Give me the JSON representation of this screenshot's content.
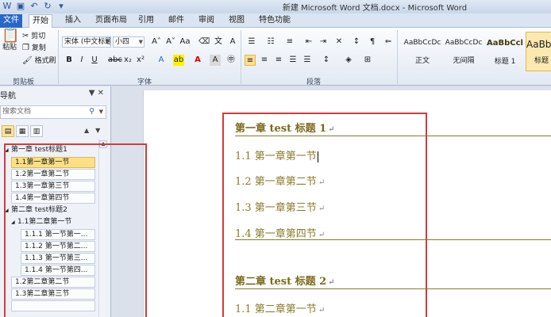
{
  "window": {
    "title": "新建 Microsoft Word 文档.docx - Microsoft Word"
  },
  "ribbon": {
    "tabs": [
      {
        "label": "文件"
      },
      {
        "label": "开始"
      },
      {
        "label": "插入"
      },
      {
        "label": "页面布局"
      },
      {
        "label": "引用"
      },
      {
        "label": "邮件"
      },
      {
        "label": "审阅"
      },
      {
        "label": "视图"
      },
      {
        "label": "特色功能"
      }
    ],
    "clipboard": {
      "paste": "粘贴",
      "cut": "剪切",
      "copy": "复制",
      "format_painter": "格式刷",
      "group": "剪贴板"
    },
    "font": {
      "name": "宋体 (中文标题",
      "size": "小四",
      "group": "字体"
    },
    "paragraph": {
      "group": "段落"
    },
    "styles": [
      {
        "preview": "AaBbCcDc",
        "name": "正文"
      },
      {
        "preview": "AaBbCcDc",
        "name": "无间隔"
      },
      {
        "preview": "AaBbCcl",
        "name": "标题 1"
      },
      {
        "preview": "AaBbC",
        "name": "标题"
      }
    ]
  },
  "nav": {
    "title": "导航",
    "search_placeholder": "搜索文档",
    "tree": [
      {
        "label": "第一章  test标题1",
        "level": 0,
        "expand": "◢"
      },
      {
        "label": "1.1第一章第一节",
        "level": 1,
        "selected": true
      },
      {
        "label": "1.2第一章第二节",
        "level": 1
      },
      {
        "label": "1.3第一章第三节",
        "level": 1
      },
      {
        "label": "1.4第一章第四节",
        "level": 1
      },
      {
        "label": "第二章  test标题2",
        "level": 0,
        "expand": "◢"
      },
      {
        "label": "1.1第二章第一节",
        "level": 1,
        "expand": "◢"
      },
      {
        "label": "1.1.1 第一节第一...",
        "level": 2
      },
      {
        "label": "1.1.2 第一节第二...",
        "level": 2
      },
      {
        "label": "1.1.3 第一节第三...",
        "level": 2
      },
      {
        "label": "1.1.4 第一节第四...",
        "level": 2
      },
      {
        "label": "1.2第二章第二节",
        "level": 1
      },
      {
        "label": "1.3第二章第三节",
        "level": 1
      }
    ]
  },
  "document": {
    "lines": [
      {
        "text": "第一章   test 标题 1",
        "style": "h1"
      },
      {
        "text": "1.1 第一章第一节",
        "style": "h2",
        "cursor": true
      },
      {
        "text": "1.2 第一章第二节",
        "style": "h2"
      },
      {
        "text": "1.3 第一章第三节",
        "style": "h2"
      },
      {
        "text": "1.4 第一章第四节",
        "style": "h2"
      },
      {
        "text": "第二章   test 标题 2",
        "style": "h1"
      },
      {
        "text": "1.1 第二章第一节",
        "style": "h2"
      }
    ],
    "para_mark": "↵"
  },
  "colors": {
    "heading": "#7a6a1c",
    "annotation": "#d43b3b",
    "file_tab": "#2a66c9"
  }
}
